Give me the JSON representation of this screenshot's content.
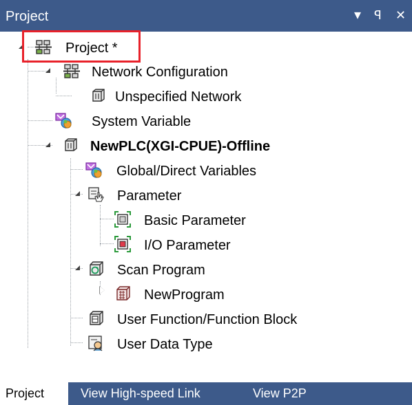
{
  "panel": {
    "title": "Project",
    "buttons": {
      "dropdown": "▾",
      "pin": "ꟼ",
      "close": "✕"
    }
  },
  "tree": {
    "root": "Project *",
    "network_configuration": "Network Configuration",
    "unspecified_network": "Unspecified Network",
    "system_variable": "System Variable",
    "plc": "NewPLC(XGI-CPUE)-Offline",
    "global_direct_variables": "Global/Direct Variables",
    "parameter": "Parameter",
    "basic_parameter": "Basic Parameter",
    "io_parameter": "I/O Parameter",
    "scan_program": "Scan Program",
    "new_program": "NewProgram",
    "user_function_block": "User Function/Function Block",
    "user_data_type": "User Data Type"
  },
  "tabs": [
    "Project",
    "View High-speed Link",
    "View P2P"
  ],
  "colors": {
    "titlebar": "#3d5a8a",
    "highlight": "#e8212a",
    "background": "#ffffff"
  },
  "icons": {
    "root": "project-network-icon",
    "network_configuration": "network-config-icon",
    "unspecified_network": "network-icon",
    "system_variable": "variables-icon",
    "plc": "plc-icon",
    "global_direct_variables": "variables-icon",
    "parameter": "parameter-hand-icon",
    "basic_parameter": "basic-parameter-icon",
    "io_parameter": "io-parameter-icon",
    "scan_program": "scan-program-icon",
    "new_program": "ladder-program-icon",
    "user_function_block": "function-block-icon",
    "user_data_type": "data-type-icon"
  }
}
